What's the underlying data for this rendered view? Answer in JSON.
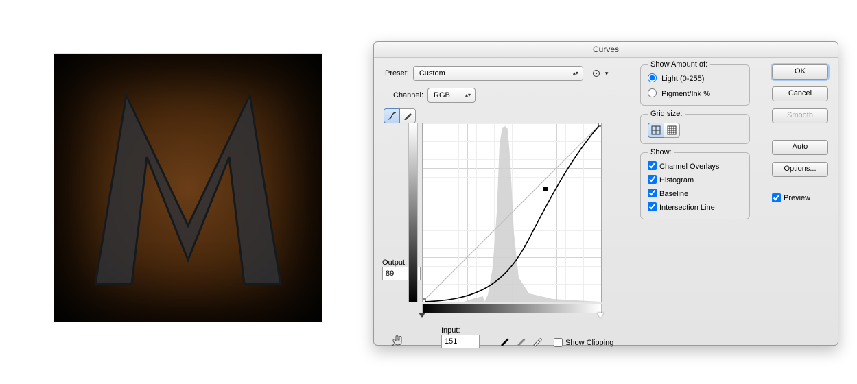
{
  "dialog": {
    "title": "Curves",
    "preset_label": "Preset:",
    "preset_value": "Custom",
    "channel_label": "Channel:",
    "channel_value": "RGB",
    "output_label": "Output:",
    "output_value": "89",
    "input_label": "Input:",
    "input_value": "151",
    "show_clipping": "Show Clipping"
  },
  "show_amount": {
    "legend": "Show Amount of:",
    "light": "Light  (0-255)",
    "pigment": "Pigment/Ink %"
  },
  "grid": {
    "legend": "Grid size:"
  },
  "show": {
    "legend": "Show:",
    "items": [
      "Channel Overlays",
      "Histogram",
      "Baseline",
      "Intersection Line"
    ]
  },
  "buttons": {
    "ok": "OK",
    "cancel": "Cancel",
    "smooth": "Smooth",
    "auto": "Auto",
    "options": "Options...",
    "preview": "Preview"
  },
  "chart_data": {
    "type": "line",
    "title": "Curves",
    "xlabel": "Input",
    "ylabel": "Output",
    "xlim": [
      0,
      255
    ],
    "ylim": [
      0,
      255
    ],
    "series": [
      {
        "name": "Baseline",
        "x": [
          0,
          255
        ],
        "y": [
          0,
          255
        ]
      },
      {
        "name": "Curve",
        "x": [
          0,
          64,
          128,
          151,
          192,
          255
        ],
        "y": [
          0,
          10,
          48,
          89,
          160,
          255
        ]
      }
    ],
    "control_point": {
      "input": 151,
      "output": 89
    },
    "histogram_peak_input": 120
  }
}
